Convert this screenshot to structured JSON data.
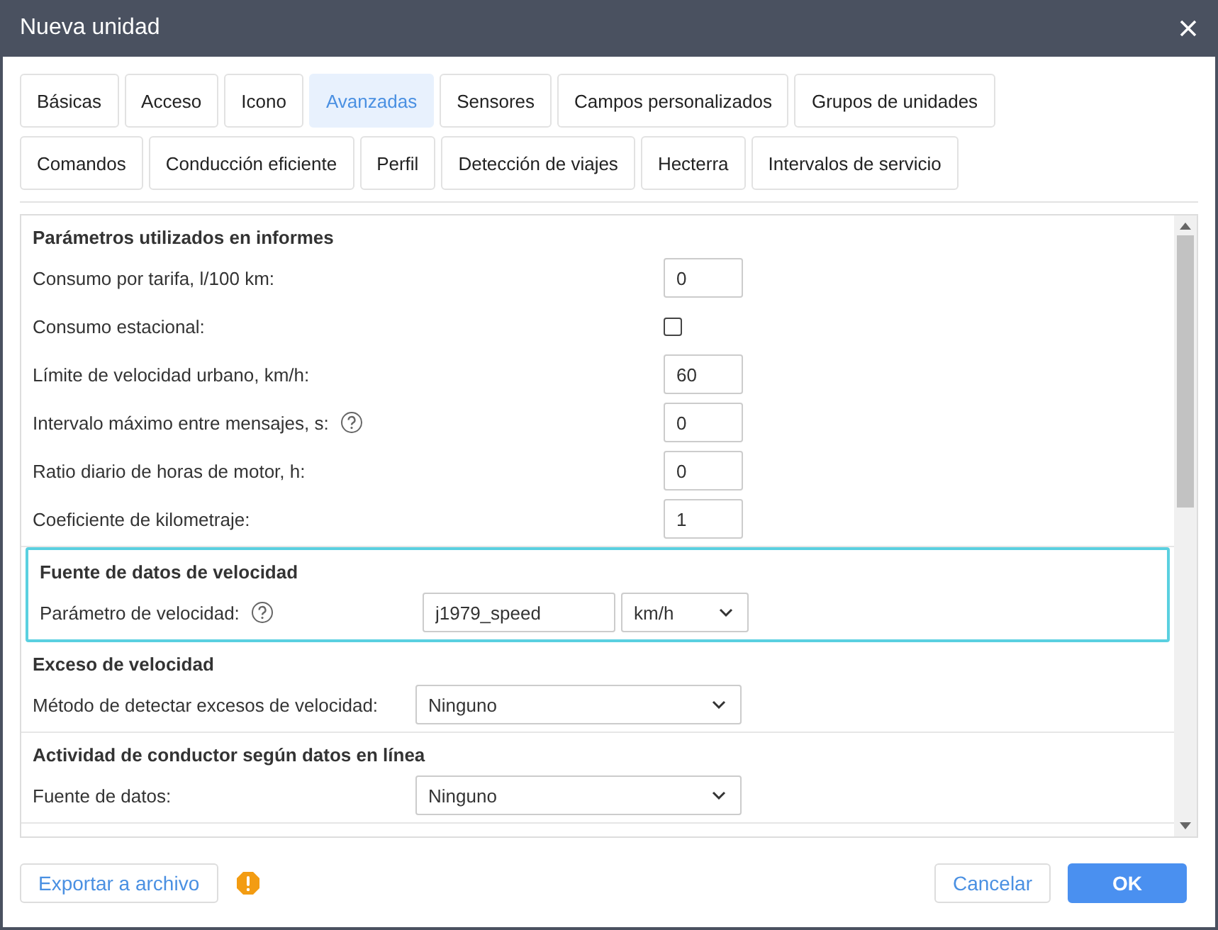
{
  "window": {
    "title": "Nueva unidad"
  },
  "tabs": [
    {
      "label": "Básicas",
      "selected": false
    },
    {
      "label": "Acceso",
      "selected": false
    },
    {
      "label": "Icono",
      "selected": false
    },
    {
      "label": "Avanzadas",
      "selected": true
    },
    {
      "label": "Sensores",
      "selected": false
    },
    {
      "label": "Campos personalizados",
      "selected": false
    },
    {
      "label": "Grupos de unidades",
      "selected": false
    },
    {
      "label": "Comandos",
      "selected": false
    },
    {
      "label": "Conducción eficiente",
      "selected": false
    },
    {
      "label": "Perfil",
      "selected": false
    },
    {
      "label": "Detección de viajes",
      "selected": false
    },
    {
      "label": "Hecterra",
      "selected": false
    },
    {
      "label": "Intervalos de servicio",
      "selected": false
    }
  ],
  "sections": [
    {
      "title": "Parámetros utilizados en informes",
      "focused": false,
      "rows": [
        {
          "kind": "input",
          "label": "Consumo por tarifa, l/100 km:",
          "help": false,
          "value": "0"
        },
        {
          "kind": "checkbox",
          "label": "Consumo estacional:",
          "help": false,
          "checked": false
        },
        {
          "kind": "input",
          "label": "Límite de velocidad urbano, km/h:",
          "help": false,
          "value": "60"
        },
        {
          "kind": "input",
          "label": "Intervalo máximo entre mensajes, s:",
          "help": true,
          "value": "0"
        },
        {
          "kind": "input",
          "label": "Ratio diario de horas de motor, h:",
          "help": false,
          "value": "0"
        },
        {
          "kind": "input",
          "label": "Coeficiente de kilometraje:",
          "help": false,
          "value": "1"
        }
      ]
    },
    {
      "title": "Fuente de datos de velocidad",
      "focused": true,
      "rows": [
        {
          "kind": "input_unit",
          "label": "Parámetro de velocidad:",
          "help": true,
          "value": "j1979_speed",
          "unit": "km/h"
        }
      ]
    },
    {
      "title": "Exceso de velocidad",
      "focused": false,
      "rows": [
        {
          "kind": "select",
          "label": "Método de detectar excesos de velocidad:",
          "help": false,
          "value": "Ninguno"
        }
      ]
    },
    {
      "title": "Actividad de conductor según datos en línea",
      "focused": false,
      "rows": [
        {
          "kind": "select",
          "label": "Fuente de datos:",
          "help": false,
          "value": "Ninguno"
        }
      ]
    }
  ],
  "footer": {
    "export": "Exportar a archivo",
    "warning": true,
    "cancel": "Cancelar",
    "ok": "OK"
  }
}
